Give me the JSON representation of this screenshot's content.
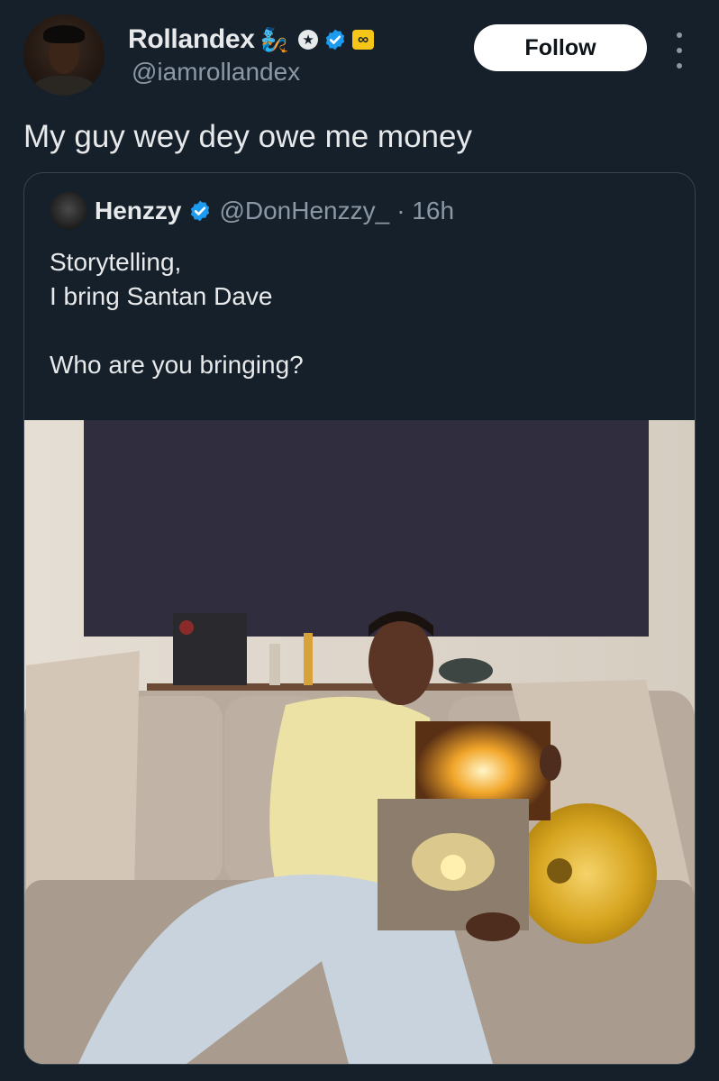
{
  "post": {
    "author": {
      "display_name": "Rollandex",
      "name_emoji": "🧞",
      "handle": "@iamrollandex",
      "badges": [
        "star-badge-icon",
        "verified-badge-icon",
        "infinity-badge-icon"
      ],
      "infinity_glyph": "∞",
      "star_glyph": "★"
    },
    "follow_label": "Follow",
    "text": "My guy wey dey owe me money"
  },
  "quote": {
    "display_name": "Henzzy",
    "handle": "@DonHenzzy_",
    "meta": "· 16h",
    "text": "Storytelling,\nI bring Santan Dave\n\nWho are you bringing?"
  },
  "colors": {
    "background": "#15202b",
    "primary_text": "#e7e9ea",
    "secondary_text": "#8b98a5",
    "verified_blue": "#1d9bf0",
    "border": "#38444d"
  }
}
